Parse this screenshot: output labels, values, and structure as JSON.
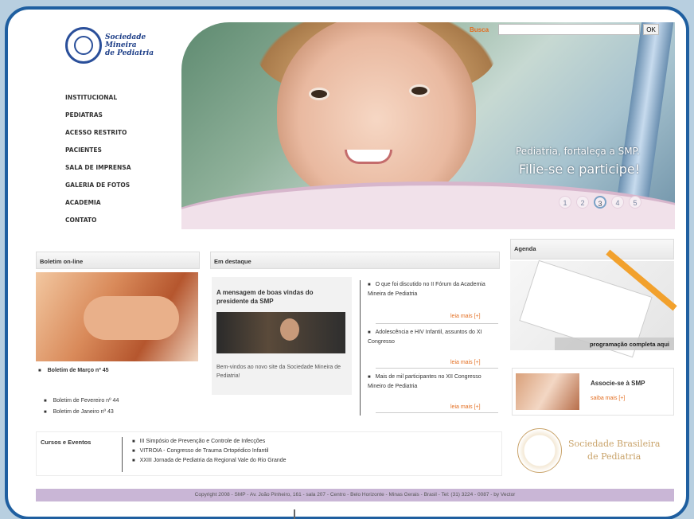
{
  "logo": {
    "line1": "Sociedade",
    "line2": "Mineira",
    "line3": "de Pediatria"
  },
  "search": {
    "label": "Busca",
    "value": "",
    "button": "OK"
  },
  "nav": [
    "INSTITUCIONAL",
    "PEDIATRAS",
    "ACESSO RESTRITO",
    "PACIENTES",
    "SALA DE IMPRENSA",
    "GALERIA DE FOTOS",
    "ACADEMIA",
    "CONTATO"
  ],
  "hero": {
    "slogan1": "Pediatria, fortaleça a SMP.",
    "slogan2": "Filie-se e participe!",
    "pages": [
      "1",
      "2",
      "3",
      "4",
      "5"
    ]
  },
  "boletim": {
    "title": "Boletim on-line",
    "featured": "Boletim de Março nº 45",
    "items": [
      "Boletim de Fevereiro nº 44",
      "Boletim de Janeiro nº 43"
    ]
  },
  "destaque": {
    "title": "Em destaque",
    "card_title": "A mensagem de boas vindas do presidente da SMP",
    "card_desc": "Bem-vindos ao novo site da Sociedade Mineira de Pediatria!",
    "items": [
      "O que foi discutido no II Fórum da Academia Mineira de Pediatria",
      "Adolescência e HIV Infantil, assuntos do XI Congresso",
      "Mais de mil participantes no XII Congresso Mineiro de Pediatria"
    ],
    "more": "leia mais [+]"
  },
  "agenda": {
    "title": "Agenda",
    "link": "programação completa aqui"
  },
  "associe": {
    "title": "Associe-se à SMP",
    "more": "saiba mais [+]"
  },
  "cursos": {
    "title": "Cursos e Eventos",
    "items": [
      "III Simpósio de Prevenção e Controle de Infecções",
      "VITROIA - Congresso de Trauma Ortopédico Infantil",
      "XXIII Jornada de Pediatria da Regional Vale do Rio Grande"
    ]
  },
  "sbp": {
    "line1": "Sociedade Brasileira",
    "line2": "de Pediatria"
  },
  "footer": "Copyright 2008 - SMP - Av. João Pinheiro, 161 - sala 207 - Centro - Belo Horizonte - Minas Gerais - Brasil - Tel: (31) 3224 - 0087 - by Vector"
}
